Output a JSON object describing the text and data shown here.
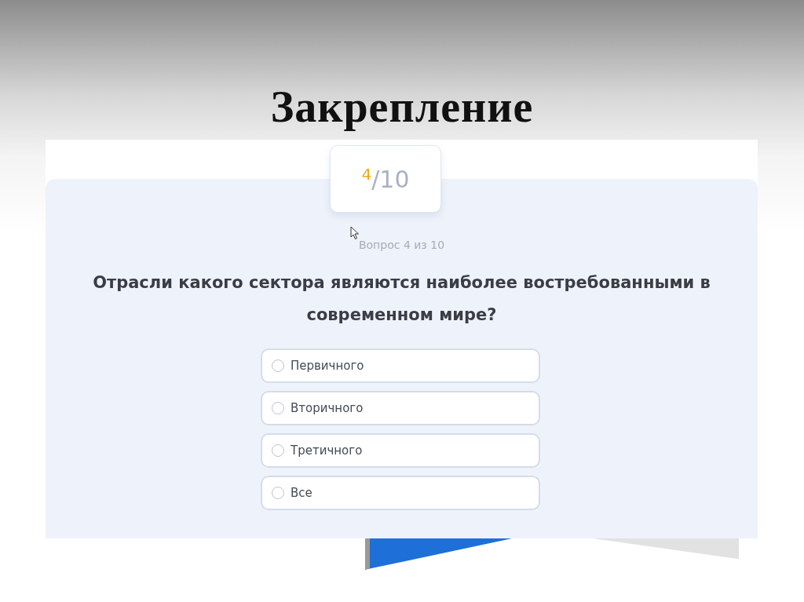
{
  "slide": {
    "title": "Закрепление"
  },
  "quiz": {
    "counter": {
      "current": "4",
      "total": "/10"
    },
    "progress_text": "Вопрос 4 из 10",
    "question": "Отрасли какого сектора являются наиболее востребованными в современном мире?",
    "options": [
      {
        "label": "Первичного",
        "selected": false
      },
      {
        "label": "Вторичного",
        "selected": false
      },
      {
        "label": "Третичного",
        "selected": false
      },
      {
        "label": "Все",
        "selected": false
      }
    ]
  }
}
